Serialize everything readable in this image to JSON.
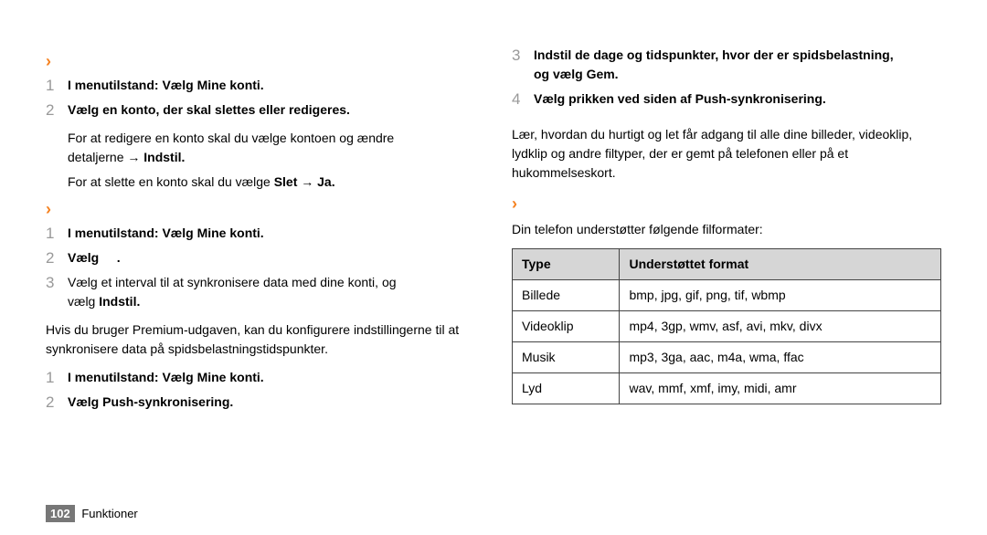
{
  "left": {
    "sec1": {
      "step1_prefix": "I menutilstand: Vælg ",
      "step1_bold": "Mine konti.",
      "step2": "Vælg en konto, der skal slettes eller redigeres.",
      "sub1a": "For at redigere en konto skal du vælge kontoen og ændre",
      "sub1b_prefix": "detaljerne → ",
      "sub1b_bold": "Indstil.",
      "sub2_prefix": "For at slette en konto skal du vælge ",
      "sub2_bold": "Slet → Ja."
    },
    "sec2": {
      "step1_prefix": "I menutilstand: Vælg ",
      "step1_bold": "Mine konti.",
      "step2_prefix": "Vælg",
      "step2_suffix": ".",
      "step3a": "Vælg et interval til at synkronisere data med dine konti, og",
      "step3b_prefix": "vælg ",
      "step3b_bold": "Indstil."
    },
    "para1": "Hvis du bruger Premium-udgaven, kan du konfigurere indstillingerne til at synkronisere data på spidsbelastningstidspunkter.",
    "sec3": {
      "step1_prefix": "I menutilstand: Vælg ",
      "step1_bold": "Mine konti.",
      "step2_prefix": "Vælg ",
      "step2_bold": "Push-synkronisering."
    }
  },
  "right": {
    "sec1": {
      "step3a": "Indstil de dage og tidspunkter, hvor der er spidsbelastning,",
      "step3b_prefix": "og vælg ",
      "step3b_bold": "Gem.",
      "step4_prefix": "Vælg prikken ved siden af ",
      "step4_bold": "Push-synkronisering."
    },
    "para1": "Lær, hvordan du hurtigt og let får adgang til alle dine billeder, videoklip, lydklip og andre filtyper, der er gemt på telefonen eller på et hukommelseskort.",
    "para2": "Din telefon understøtter følgende filformater:",
    "table": {
      "h1": "Type",
      "h2": "Understøttet format",
      "rows": [
        {
          "c1": "Billede",
          "c2": "bmp, jpg, gif, png, tif, wbmp"
        },
        {
          "c1": "Videoklip",
          "c2": "mp4, 3gp, wmv, asf, avi, mkv, divx"
        },
        {
          "c1": "Musik",
          "c2": "mp3, 3ga, aac, m4a, wma, ffac"
        },
        {
          "c1": "Lyd",
          "c2": "wav, mmf, xmf, imy, midi, amr"
        }
      ]
    }
  },
  "footer": {
    "page": "102",
    "section": "Funktioner"
  }
}
